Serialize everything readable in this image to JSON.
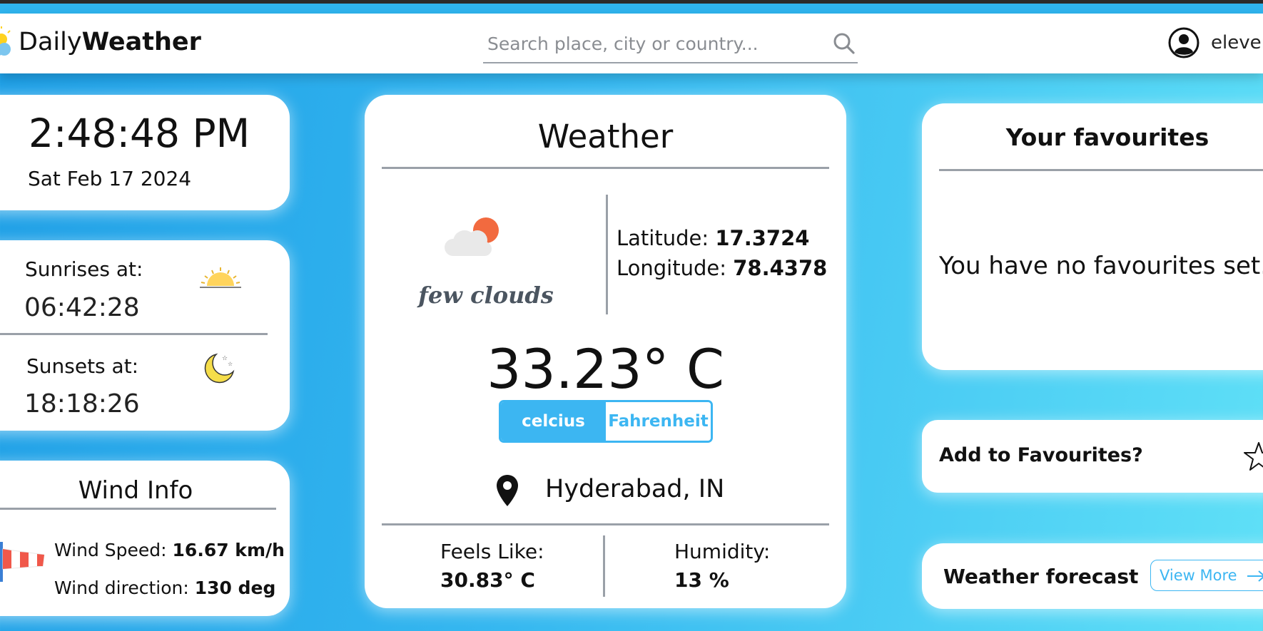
{
  "header": {
    "brand_light": "Daily",
    "brand_bold": "Weather",
    "search_placeholder": "Search place, city or country...",
    "username": "eleven"
  },
  "clock": {
    "time": "2:48:48 PM",
    "date": "Sat Feb 17 2024"
  },
  "sun": {
    "sunrise_label": "Sunrises at:",
    "sunrise_time": "06:42:28",
    "sunset_label": "Sunsets at:",
    "sunset_time": "18:18:26"
  },
  "wind": {
    "title": "Wind Info",
    "speed_label": "Wind Speed:",
    "speed_value": "16.67 km/h",
    "direction_label": "Wind direction:",
    "direction_value": "130 deg"
  },
  "weather": {
    "title": "Weather",
    "description": "few clouds",
    "latitude_label": "Latitude:",
    "latitude_value": "17.3724",
    "longitude_label": "Longitude:",
    "longitude_value": "78.4378",
    "temperature": "33.23° C",
    "unit_celsius": "celcius",
    "unit_fahrenheit": "Fahrenheit",
    "location": "Hyderabad, IN",
    "feels_like_label": "Feels Like:",
    "feels_like_value": "30.83° C",
    "humidity_label": "Humidity:",
    "humidity_value": "13 %"
  },
  "favourites": {
    "title": "Your favourites",
    "empty_message": "You have no favourites set."
  },
  "add_favourite": {
    "label": "Add to Favourites?"
  },
  "forecast": {
    "label": "Weather forecast",
    "button": "View More"
  },
  "colors": {
    "accent": "#3cb6f2",
    "background_start": "#1e9fe6",
    "background_end": "#5fe0f7",
    "divider": "#9aa0a8",
    "description_text": "#4b5560"
  },
  "icons": {
    "logo": "sun-cloud-icon",
    "search": "search-icon",
    "user": "user-circle-icon",
    "sunrise": "sunrise-icon",
    "sunset": "moon-icon",
    "wind": "windsock-icon",
    "weather": "few-clouds-icon",
    "location": "map-pin-icon",
    "favourite": "star-icon",
    "arrow": "arrow-right-icon"
  }
}
